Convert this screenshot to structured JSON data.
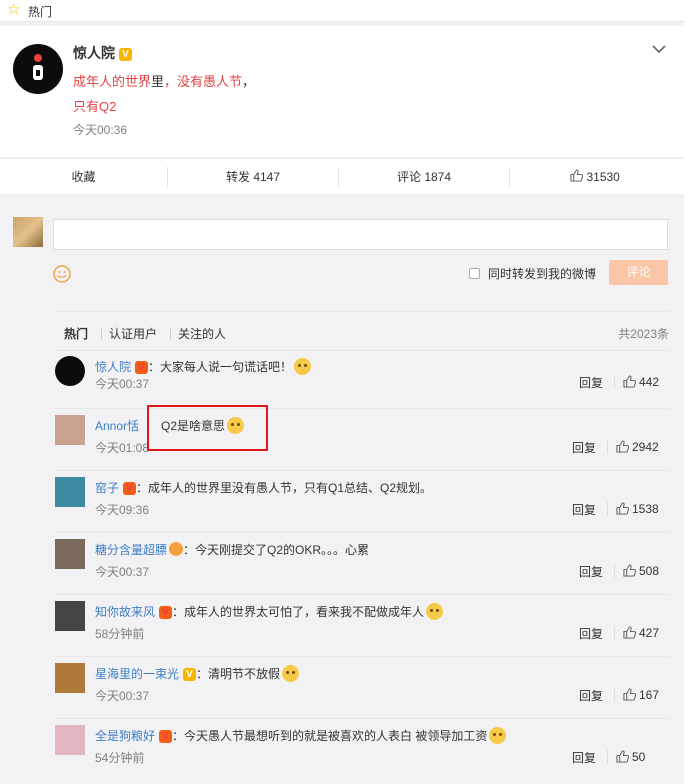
{
  "topbar": {
    "label": "热门",
    "icon": "star-icon"
  },
  "post": {
    "name": "惊人院",
    "badge": "V",
    "line1_part1": "成年人的世界",
    "line1_part2": "里",
    "line1_part3": "，没有愚人节",
    "line1_part4": "，",
    "line2": "只有Q2",
    "time": "今天00:36"
  },
  "actions": {
    "collect": "收藏",
    "repost": "转发 4147",
    "comment": "评论 1874",
    "like": "31530"
  },
  "compose": {
    "placeholder": "",
    "checkbox_label": "同时转发到我的微博",
    "submit": "评论"
  },
  "comments": {
    "tabs": [
      "热门",
      "认证用户",
      "关注的人"
    ],
    "total": "共2023条",
    "reply_label": "回复",
    "items": [
      {
        "user": "惊人院",
        "badge": "V",
        "sep": "：",
        "text": "大家每人说一句谎话吧！",
        "time": "今天00:37",
        "likes": "442",
        "avatar_color": "#0c0c0c",
        "emoji": true
      },
      {
        "user": "Annor恬",
        "badge": "",
        "sep": "",
        "text": "Q2是啥意思",
        "time": "今天01:08",
        "likes": "2942",
        "avatar_color": "#c9a38d",
        "emoji": true
      },
      {
        "user": "窑子",
        "badge": "V",
        "sep": "：",
        "text": "成年人的世界里没有愚人节，只有Q1总结、Q2规划。",
        "time": "今天09:36",
        "likes": "1538",
        "avatar_color": "#3d8aa3",
        "emoji": false
      },
      {
        "user": "糖分含量超膘",
        "badge": "crown",
        "sep": "：",
        "text": "今天刚提交了Q2的OKR。。。心累",
        "time": "今天00:37",
        "likes": "508",
        "avatar_color": "#7a6a5c",
        "emoji": false
      },
      {
        "user": "知你故来风",
        "badge": "V",
        "sep": "：",
        "text": "成年人的世界太可怕了，看来我不配做成年人",
        "time": "58分钟前",
        "likes": "427",
        "avatar_color": "#454545",
        "emoji": true
      },
      {
        "user": "星海里的一束光",
        "badge": "V",
        "sep": "：",
        "text": "清明节不放假",
        "time": "今天00:37",
        "likes": "167",
        "avatar_color": "#b07a3a",
        "emoji": true
      },
      {
        "user": "全是狗粮好",
        "badge": "V",
        "sep": "：",
        "text": "今天愚人节最想听到的就是被喜欢的人表白 被领导加工资",
        "time": "54分钟前",
        "likes": "50",
        "avatar_color": "#e3b6c0",
        "emoji": true
      }
    ]
  },
  "colors": {
    "link": "#3d7dc4",
    "accent": "#e64141",
    "highlight_box": "#e2141c"
  }
}
